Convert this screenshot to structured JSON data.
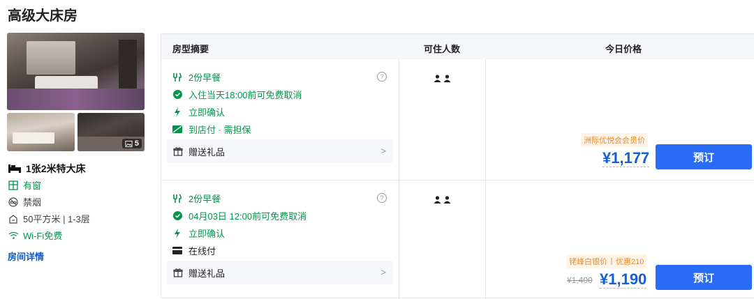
{
  "room": {
    "title": "高级大床房",
    "photo_count": "5",
    "bed": "1张2米特大床",
    "features": [
      {
        "icon": "window-icon",
        "label": "有窗"
      },
      {
        "icon": "no-smoking-icon",
        "label": "禁烟"
      },
      {
        "icon": "floor-area-icon",
        "label": "50平方米 | 1-3层"
      },
      {
        "icon": "wifi-icon",
        "label": "Wi-Fi免费"
      }
    ],
    "details_link": "房间详情"
  },
  "table": {
    "headers": {
      "summary": "房型摘要",
      "guests": "可住人数",
      "price": "今日价格"
    }
  },
  "offers": [
    {
      "breakfast": "2份早餐",
      "cancel": "入住当天18:00前可免费取消",
      "confirm": "立即确认",
      "payment": "到店付 · 需担保",
      "gift": "赠送礼品",
      "help_icon": "?",
      "tag": "洲际优悦会会员价",
      "price": "¥1,177",
      "book": "预订"
    },
    {
      "breakfast": "2份早餐",
      "cancel": "04月03日 12:00前可免费取消",
      "confirm": "立即确认",
      "payment": "在线付",
      "gift": "赠送礼品",
      "help_icon": "?",
      "tag_left": "铑峰白银价",
      "tag_right": "优惠210",
      "original_price": "¥1,400",
      "price": "¥1,190",
      "book": "预订"
    }
  ],
  "colors": {
    "green": "#07934c",
    "blue": "#1560d4",
    "button": "#2a6cf6",
    "orange": "#e58b2a"
  }
}
